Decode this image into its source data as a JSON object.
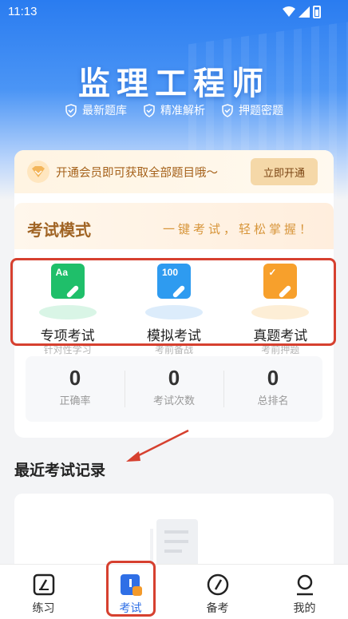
{
  "status_bar": {
    "time": "11:13"
  },
  "hero": {
    "title": "监理工程师",
    "tags": [
      "最新题库",
      "精准解析",
      "押题密题"
    ]
  },
  "vip_banner": {
    "text": "开通会员即可获取全部题目哦～",
    "button_label": "立即开通"
  },
  "exam_mode": {
    "title": "考试模式",
    "slogan": "一键考试，轻松掌握！",
    "items": [
      {
        "label": "专项考试",
        "sub": "针对性学习",
        "icon_text": "Aa",
        "icon": "pencil-note-icon",
        "color": "#1fbf6a",
        "shadow": "#d9f5e6"
      },
      {
        "label": "模拟考试",
        "sub": "考前备战",
        "icon_text": "100",
        "icon": "score-pencil-icon",
        "color": "#2e9bf0",
        "shadow": "#dcecfb"
      },
      {
        "label": "真题考试",
        "sub": "考前押题",
        "icon_text": "✓",
        "icon": "check-pencil-icon",
        "color": "#f7a02c",
        "shadow": "#fdeed6"
      }
    ]
  },
  "stats": [
    {
      "value": "0",
      "label": "正确率"
    },
    {
      "value": "0",
      "label": "考试次数"
    },
    {
      "value": "0",
      "label": "总排名"
    }
  ],
  "recent": {
    "title": "最近考试记录"
  },
  "nav": {
    "items": [
      {
        "label": "练习",
        "icon": "practice-icon",
        "active": false
      },
      {
        "label": "考试",
        "icon": "exam-icon",
        "active": true
      },
      {
        "label": "备考",
        "icon": "compass-icon",
        "active": false
      },
      {
        "label": "我的",
        "icon": "profile-icon",
        "active": false
      }
    ]
  },
  "colors": {
    "hero_blue": "#2a7cf0",
    "accent_blue": "#2f6fe6",
    "vip_gold": "#a5611a",
    "annotation_red": "#d6402f"
  }
}
